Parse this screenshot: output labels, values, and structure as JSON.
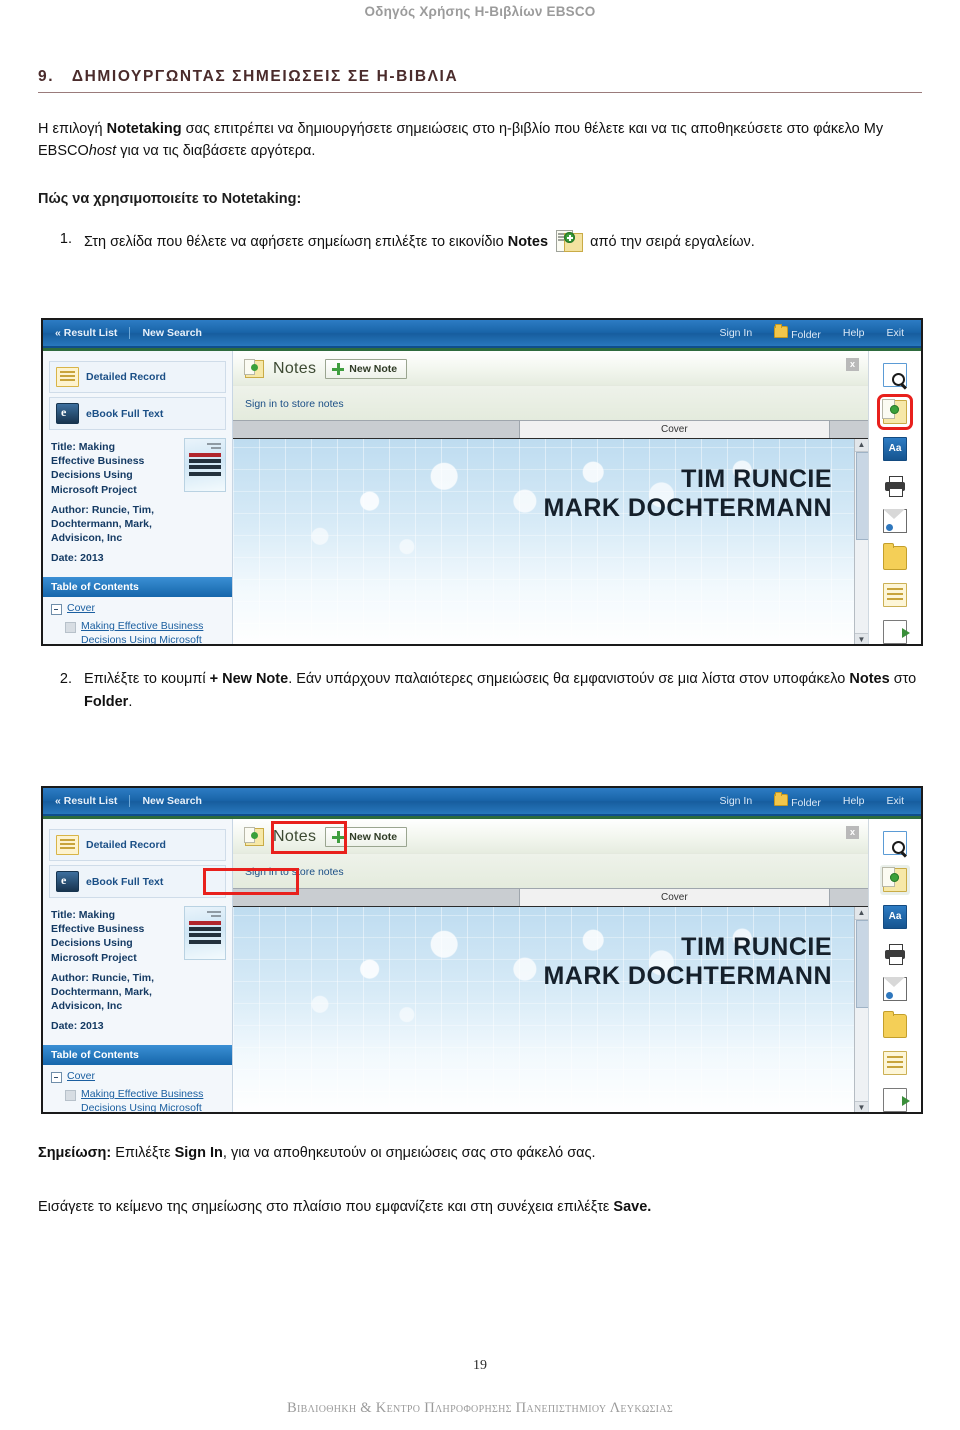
{
  "document": {
    "running_header": "Οδηγός Χρήσης Η-Βιβλίων EBSCO",
    "section_number": "9.",
    "section_title": "ΔΗΜΙΟΥΡΓΩΝΤΑΣ ΣΗΜΕΙΩΣΕΙΣ ΣΕ Η-ΒΙΒΛΙΑ",
    "page_number": "19",
    "footer": "Βιβλιοθηκη & Κεντρο Πληροφορησης Πανεπιστημιου Λευκωσιας"
  },
  "intro": {
    "part1": "Η επιλογή ",
    "bold1": "Notetaking",
    "part2": " σας επιτρέπει να δημιουργήσετε σημειώσεις στο η-βιβλίο που θέλετε και να τις αποθηκεύσετε στο φάκελο My EBSCO",
    "italic1": "host",
    "part3": " για να τις διαβάσετε αργότερα.",
    "howto_heading": "Πώς να χρησιμοποιείτε το Notetaking:"
  },
  "steps": [
    {
      "number": "1.",
      "text_before": "Στη σελίδα που θέλετε να αφήσετε σημείωση επιλέξτε το εικονίδιο ",
      "bold": "Notes",
      "text_after": " από την σειρά εργαλείων.",
      "icon": "notes-add-icon"
    },
    {
      "number": "2.",
      "text_before": "Επιλέξτε το κουμπί ",
      "bold1": "+ New Note",
      "text_mid": ". Εάν υπάρχουν παλαιότερες σημειώσεις θα εμφανιστούν σε μια λίστα στον υποφάκελο ",
      "bold2": "Notes",
      "text_mid2": " στο ",
      "bold3": "Folder",
      "text_after": "."
    }
  ],
  "closing": {
    "note_label": "Σημείωση:",
    "note_text_before": " Επιλέξτε ",
    "note_bold": "Sign In",
    "note_text_after": ", για να αποθηκευτούν οι σημειώσεις σας στο φάκελό σας.",
    "save_line_before": "Εισάγετε το κείμενο της σημείωσης στο πλαίσιο που εμφανίζετε και στη συνέχεια επιλέξτε ",
    "save_bold": "Save."
  },
  "screenshot": {
    "nav": {
      "result_list": "« Result List",
      "new_search": "New Search",
      "sign_in": "Sign In",
      "folder": "Folder",
      "help": "Help",
      "exit": "Exit"
    },
    "sidebar": {
      "detailed_record": "Detailed Record",
      "ebook_full_text": "eBook Full Text",
      "title": "Title: Making Effective Business Decisions Using Microsoft Project",
      "author": "Author: Runcie, Tim, Dochtermann, Mark, Advisicon, Inc",
      "date": "Date: 2013",
      "toc_header": "Table of Contents",
      "toc_cover": "Cover",
      "toc_item": "Making Effective Business Decisions Using Microsoft Project"
    },
    "notes_panel": {
      "title": "Notes",
      "new_note_button": "New Note",
      "sign_in_link": "Sign in to store notes",
      "close_label": "x",
      "tab_label": "Cover"
    },
    "cover": {
      "author_line1": "TIM RUNCIE",
      "author_line2": "MARK DOCHTERMANN"
    },
    "toolbar_icons": [
      "search-icon",
      "notes-icon",
      "font-size-icon",
      "print-icon",
      "email-icon",
      "folder-icon",
      "cite-icon",
      "export-icon"
    ],
    "font_icon_label": "Aa",
    "scroll_up": "▲",
    "scroll_down": "▼"
  },
  "colors": {
    "nav_blue": "#1964a8",
    "highlight_red": "#e8201c",
    "heading_maroon": "#4a2b2b",
    "link_blue": "#1b5fa0"
  }
}
